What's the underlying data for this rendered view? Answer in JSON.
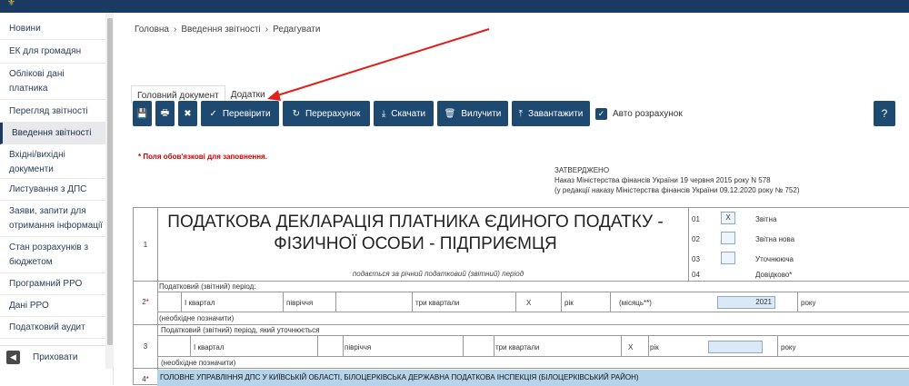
{
  "sidebar": {
    "items": [
      {
        "label": "Новини"
      },
      {
        "label": "ЕК для громадян"
      },
      {
        "label": "Облікові дані платника"
      },
      {
        "label": "Перегляд звітності"
      },
      {
        "label": "Введення звітності",
        "active": true
      },
      {
        "label": "Вхідні/вихідні документи"
      },
      {
        "label": "Листування з ДПС"
      },
      {
        "label": "Заяви, запити для отримання інформації"
      },
      {
        "label": "Стан розрахунків з бюджетом"
      },
      {
        "label": "Програмний РРО"
      },
      {
        "label": "Дані РРО"
      },
      {
        "label": "Податковий аудит"
      }
    ],
    "hide_label": "Приховати"
  },
  "breadcrumb": [
    "Головна",
    "Введення звітності",
    "Редагувати"
  ],
  "tabs": [
    "Головний документ",
    "Додатки"
  ],
  "toolbar": {
    "check": "Перевірити",
    "recalc": "Перерахунок",
    "download": "Скачати",
    "delete": "Вилучити",
    "upload": "Завантажити",
    "auto_calc": "Авто розрахунок",
    "help": "?"
  },
  "required_note": "* Поля обов'язкові для заповнення.",
  "approved": {
    "line1": "ЗАТВЕРДЖЕНО",
    "line2": "Наказ Міністерства фінансів України 19 червня 2015 року N 578",
    "line3": "(у редакції наказу Міністерства фінансів України 09.12.2020 року № 752)"
  },
  "form": {
    "row1_num": "1",
    "title_line1": "ПОДАТКОВА ДЕКЛАРАЦІЯ ПЛАТНИКА ЄДИНОГО ПОДАТКУ -",
    "title_line2": "ФІЗИЧНОЇ ОСОБИ - ПІДПРИЄМЦЯ",
    "subtitle": "подається за річний податковий (звітний) період",
    "types": [
      {
        "num": "01",
        "mark": "X",
        "label": "Звітна"
      },
      {
        "num": "02",
        "mark": "",
        "label": "Звітна нова"
      },
      {
        "num": "03",
        "mark": "",
        "label": "Уточнююча"
      },
      {
        "num": "04",
        "mark": "",
        "label": "Довідково*"
      }
    ],
    "row2_num": "2",
    "row2_star": "*",
    "row2_header": "Податковий (звітний) період:",
    "row2_q1": "І квартал",
    "row2_half": "півріччя",
    "row2_q3": "три квартали",
    "row2_x": "X",
    "row2_year": "рік",
    "row2_month": "(місяць**)",
    "row2_value": "2021",
    "row2_roku": "року",
    "row2_note": "(необхідне позначити)",
    "row3_num": "3",
    "row3_header": "Податковий (звітний) період, який уточнюється",
    "row3_q1": "І квартал",
    "row3_half": "півріччя",
    "row3_q3": "три квартали",
    "row3_x": "X",
    "row3_year": "рік",
    "row3_roku": "року",
    "row3_note": "(необхідне позначити)",
    "row4_num": "4",
    "row4_star": "*",
    "org": "ГОЛОВНЕ УПРАВЛІННЯ ДПС У КИЇВСЬКІЙ ОБЛАСТІ, БІЛОЦЕРКІВСЬКА ДЕРЖАВНА ПОДАТКОВА ІНСПЕКЦІЯ (БІЛОЦЕРКІВСЬКИЙ РАЙОН)"
  },
  "colors": {
    "primary": "#1e4a72",
    "topbar": "#1a3a64",
    "arrow": "#e0201a"
  }
}
